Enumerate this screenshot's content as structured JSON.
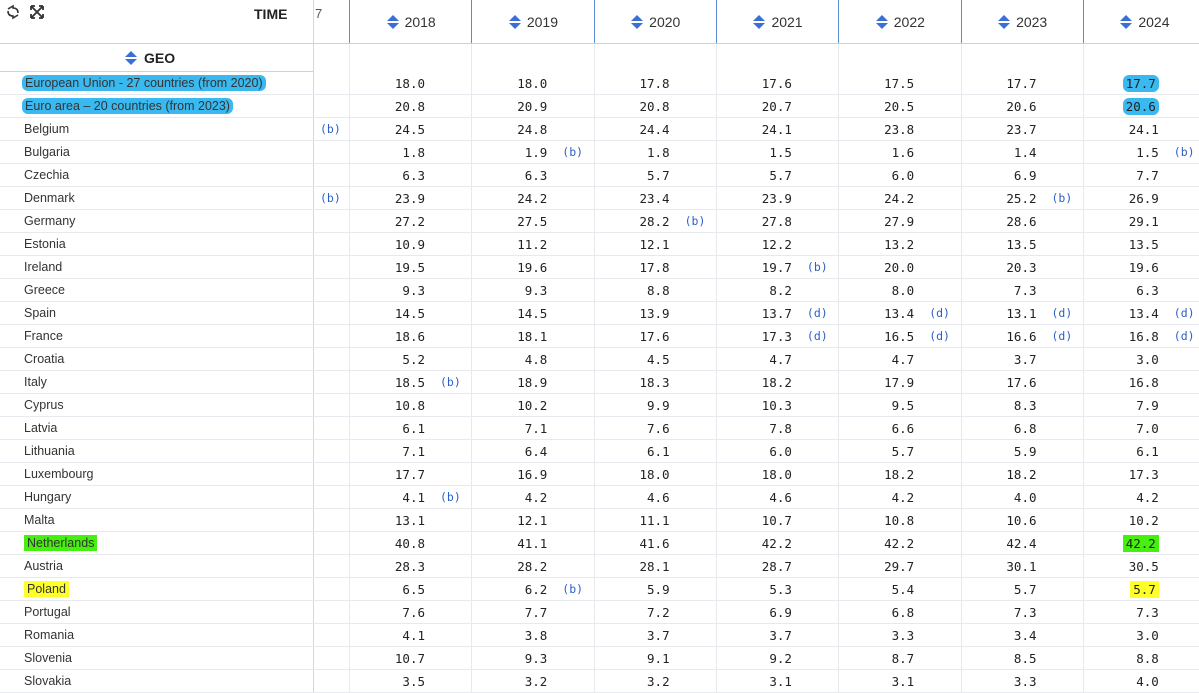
{
  "header": {
    "time_label": "TIME",
    "geo_label": "GEO",
    "partial_col": "7",
    "years": [
      "2018",
      "2019",
      "2020",
      "2021",
      "2022",
      "2023",
      "2024"
    ]
  },
  "icons": [
    "refresh-icon",
    "fullscreen-icon",
    "sort-icon"
  ],
  "colors": {
    "accent": "#3b6fd8",
    "flag": "#2c5fc9",
    "hl_blue": "#39b9ef",
    "hl_green": "#45ef0e",
    "hl_yellow": "#ffff2a"
  },
  "rows": [
    {
      "country": "European Union - 27 countries (from 2020)",
      "hl": "blue",
      "pre": "",
      "cells": [
        [
          "18.0",
          ""
        ],
        [
          "18.0",
          ""
        ],
        [
          "17.8",
          ""
        ],
        [
          "17.6",
          ""
        ],
        [
          "17.5",
          ""
        ],
        [
          "17.7",
          ""
        ],
        [
          "17.7",
          ""
        ]
      ],
      "hl_last": "blue"
    },
    {
      "country": "Euro area – 20 countries (from 2023)",
      "hl": "blue",
      "pre": "",
      "cells": [
        [
          "20.8",
          ""
        ],
        [
          "20.9",
          ""
        ],
        [
          "20.8",
          ""
        ],
        [
          "20.7",
          ""
        ],
        [
          "20.5",
          ""
        ],
        [
          "20.6",
          ""
        ],
        [
          "20.6",
          ""
        ]
      ],
      "hl_last": "blue"
    },
    {
      "country": "Belgium",
      "hl": "",
      "pre": "(b)",
      "cells": [
        [
          "24.5",
          ""
        ],
        [
          "24.8",
          ""
        ],
        [
          "24.4",
          ""
        ],
        [
          "24.1",
          ""
        ],
        [
          "23.8",
          ""
        ],
        [
          "23.7",
          ""
        ],
        [
          "24.1",
          ""
        ]
      ],
      "hl_last": ""
    },
    {
      "country": "Bulgaria",
      "hl": "",
      "pre": "",
      "cells": [
        [
          "1.8",
          ""
        ],
        [
          "1.9",
          "(b)"
        ],
        [
          "1.8",
          ""
        ],
        [
          "1.5",
          ""
        ],
        [
          "1.6",
          ""
        ],
        [
          "1.4",
          ""
        ],
        [
          "1.5",
          "(b)"
        ]
      ],
      "hl_last": ""
    },
    {
      "country": "Czechia",
      "hl": "",
      "pre": "",
      "cells": [
        [
          "6.3",
          ""
        ],
        [
          "6.3",
          ""
        ],
        [
          "5.7",
          ""
        ],
        [
          "5.7",
          ""
        ],
        [
          "6.0",
          ""
        ],
        [
          "6.9",
          ""
        ],
        [
          "7.7",
          ""
        ]
      ],
      "hl_last": ""
    },
    {
      "country": "Denmark",
      "hl": "",
      "pre": "(b)",
      "cells": [
        [
          "23.9",
          ""
        ],
        [
          "24.2",
          ""
        ],
        [
          "23.4",
          ""
        ],
        [
          "23.9",
          ""
        ],
        [
          "24.2",
          ""
        ],
        [
          "25.2",
          "(b)"
        ],
        [
          "26.9",
          ""
        ]
      ],
      "hl_last": ""
    },
    {
      "country": "Germany",
      "hl": "",
      "pre": "",
      "cells": [
        [
          "27.2",
          ""
        ],
        [
          "27.5",
          ""
        ],
        [
          "28.2",
          "(b)"
        ],
        [
          "27.8",
          ""
        ],
        [
          "27.9",
          ""
        ],
        [
          "28.6",
          ""
        ],
        [
          "29.1",
          ""
        ]
      ],
      "hl_last": ""
    },
    {
      "country": "Estonia",
      "hl": "",
      "pre": "",
      "cells": [
        [
          "10.9",
          ""
        ],
        [
          "11.2",
          ""
        ],
        [
          "12.1",
          ""
        ],
        [
          "12.2",
          ""
        ],
        [
          "13.2",
          ""
        ],
        [
          "13.5",
          ""
        ],
        [
          "13.5",
          ""
        ]
      ],
      "hl_last": ""
    },
    {
      "country": "Ireland",
      "hl": "",
      "pre": "",
      "cells": [
        [
          "19.5",
          ""
        ],
        [
          "19.6",
          ""
        ],
        [
          "17.8",
          ""
        ],
        [
          "19.7",
          "(b)"
        ],
        [
          "20.0",
          ""
        ],
        [
          "20.3",
          ""
        ],
        [
          "19.6",
          ""
        ]
      ],
      "hl_last": ""
    },
    {
      "country": "Greece",
      "hl": "",
      "pre": "",
      "cells": [
        [
          "9.3",
          ""
        ],
        [
          "9.3",
          ""
        ],
        [
          "8.8",
          ""
        ],
        [
          "8.2",
          ""
        ],
        [
          "8.0",
          ""
        ],
        [
          "7.3",
          ""
        ],
        [
          "6.3",
          ""
        ]
      ],
      "hl_last": ""
    },
    {
      "country": "Spain",
      "hl": "",
      "pre": "",
      "cells": [
        [
          "14.5",
          ""
        ],
        [
          "14.5",
          ""
        ],
        [
          "13.9",
          ""
        ],
        [
          "13.7",
          "(d)"
        ],
        [
          "13.4",
          "(d)"
        ],
        [
          "13.1",
          "(d)"
        ],
        [
          "13.4",
          "(d)"
        ]
      ],
      "hl_last": ""
    },
    {
      "country": "France",
      "hl": "",
      "pre": "",
      "cells": [
        [
          "18.6",
          ""
        ],
        [
          "18.1",
          ""
        ],
        [
          "17.6",
          ""
        ],
        [
          "17.3",
          "(d)"
        ],
        [
          "16.5",
          "(d)"
        ],
        [
          "16.6",
          "(d)"
        ],
        [
          "16.8",
          "(d)"
        ]
      ],
      "hl_last": ""
    },
    {
      "country": "Croatia",
      "hl": "",
      "pre": "",
      "cells": [
        [
          "5.2",
          ""
        ],
        [
          "4.8",
          ""
        ],
        [
          "4.5",
          ""
        ],
        [
          "4.7",
          ""
        ],
        [
          "4.7",
          ""
        ],
        [
          "3.7",
          ""
        ],
        [
          "3.0",
          ""
        ]
      ],
      "hl_last": ""
    },
    {
      "country": "Italy",
      "hl": "",
      "pre": "",
      "cells": [
        [
          "18.5",
          "(b)"
        ],
        [
          "18.9",
          ""
        ],
        [
          "18.3",
          ""
        ],
        [
          "18.2",
          ""
        ],
        [
          "17.9",
          ""
        ],
        [
          "17.6",
          ""
        ],
        [
          "16.8",
          ""
        ]
      ],
      "hl_last": ""
    },
    {
      "country": "Cyprus",
      "hl": "",
      "pre": "",
      "cells": [
        [
          "10.8",
          ""
        ],
        [
          "10.2",
          ""
        ],
        [
          "9.9",
          ""
        ],
        [
          "10.3",
          ""
        ],
        [
          "9.5",
          ""
        ],
        [
          "8.3",
          ""
        ],
        [
          "7.9",
          ""
        ]
      ],
      "hl_last": ""
    },
    {
      "country": "Latvia",
      "hl": "",
      "pre": "",
      "cells": [
        [
          "6.1",
          ""
        ],
        [
          "7.1",
          ""
        ],
        [
          "7.6",
          ""
        ],
        [
          "7.8",
          ""
        ],
        [
          "6.6",
          ""
        ],
        [
          "6.8",
          ""
        ],
        [
          "7.0",
          ""
        ]
      ],
      "hl_last": ""
    },
    {
      "country": "Lithuania",
      "hl": "",
      "pre": "",
      "cells": [
        [
          "7.1",
          ""
        ],
        [
          "6.4",
          ""
        ],
        [
          "6.1",
          ""
        ],
        [
          "6.0",
          ""
        ],
        [
          "5.7",
          ""
        ],
        [
          "5.9",
          ""
        ],
        [
          "6.1",
          ""
        ]
      ],
      "hl_last": ""
    },
    {
      "country": "Luxembourg",
      "hl": "",
      "pre": "",
      "cells": [
        [
          "17.7",
          ""
        ],
        [
          "16.9",
          ""
        ],
        [
          "18.0",
          ""
        ],
        [
          "18.0",
          ""
        ],
        [
          "18.2",
          ""
        ],
        [
          "18.2",
          ""
        ],
        [
          "17.3",
          ""
        ]
      ],
      "hl_last": ""
    },
    {
      "country": "Hungary",
      "hl": "",
      "pre": "",
      "cells": [
        [
          "4.1",
          "(b)"
        ],
        [
          "4.2",
          ""
        ],
        [
          "4.6",
          ""
        ],
        [
          "4.6",
          ""
        ],
        [
          "4.2",
          ""
        ],
        [
          "4.0",
          ""
        ],
        [
          "4.2",
          ""
        ]
      ],
      "hl_last": ""
    },
    {
      "country": "Malta",
      "hl": "",
      "pre": "",
      "cells": [
        [
          "13.1",
          ""
        ],
        [
          "12.1",
          ""
        ],
        [
          "11.1",
          ""
        ],
        [
          "10.7",
          ""
        ],
        [
          "10.8",
          ""
        ],
        [
          "10.6",
          ""
        ],
        [
          "10.2",
          ""
        ]
      ],
      "hl_last": ""
    },
    {
      "country": "Netherlands",
      "hl": "green",
      "pre": "",
      "cells": [
        [
          "40.8",
          ""
        ],
        [
          "41.1",
          ""
        ],
        [
          "41.6",
          ""
        ],
        [
          "42.2",
          ""
        ],
        [
          "42.2",
          ""
        ],
        [
          "42.4",
          ""
        ],
        [
          "42.2",
          ""
        ]
      ],
      "hl_last": "green"
    },
    {
      "country": "Austria",
      "hl": "",
      "pre": "",
      "cells": [
        [
          "28.3",
          ""
        ],
        [
          "28.2",
          ""
        ],
        [
          "28.1",
          ""
        ],
        [
          "28.7",
          ""
        ],
        [
          "29.7",
          ""
        ],
        [
          "30.1",
          ""
        ],
        [
          "30.5",
          ""
        ]
      ],
      "hl_last": ""
    },
    {
      "country": "Poland",
      "hl": "yellow",
      "pre": "",
      "cells": [
        [
          "6.5",
          ""
        ],
        [
          "6.2",
          "(b)"
        ],
        [
          "5.9",
          ""
        ],
        [
          "5.3",
          ""
        ],
        [
          "5.4",
          ""
        ],
        [
          "5.7",
          ""
        ],
        [
          "5.7",
          ""
        ]
      ],
      "hl_last": "yellow"
    },
    {
      "country": "Portugal",
      "hl": "",
      "pre": "",
      "cells": [
        [
          "7.6",
          ""
        ],
        [
          "7.7",
          ""
        ],
        [
          "7.2",
          ""
        ],
        [
          "6.9",
          ""
        ],
        [
          "6.8",
          ""
        ],
        [
          "7.3",
          ""
        ],
        [
          "7.3",
          ""
        ]
      ],
      "hl_last": ""
    },
    {
      "country": "Romania",
      "hl": "",
      "pre": "",
      "cells": [
        [
          "4.1",
          ""
        ],
        [
          "3.8",
          ""
        ],
        [
          "3.7",
          ""
        ],
        [
          "3.7",
          ""
        ],
        [
          "3.3",
          ""
        ],
        [
          "3.4",
          ""
        ],
        [
          "3.0",
          ""
        ]
      ],
      "hl_last": ""
    },
    {
      "country": "Slovenia",
      "hl": "",
      "pre": "",
      "cells": [
        [
          "10.7",
          ""
        ],
        [
          "9.3",
          ""
        ],
        [
          "9.1",
          ""
        ],
        [
          "9.2",
          ""
        ],
        [
          "8.7",
          ""
        ],
        [
          "8.5",
          ""
        ],
        [
          "8.8",
          ""
        ]
      ],
      "hl_last": ""
    },
    {
      "country": "Slovakia",
      "hl": "",
      "pre": "",
      "cells": [
        [
          "3.5",
          ""
        ],
        [
          "3.2",
          ""
        ],
        [
          "3.2",
          ""
        ],
        [
          "3.1",
          ""
        ],
        [
          "3.1",
          ""
        ],
        [
          "3.3",
          ""
        ],
        [
          "4.0",
          ""
        ]
      ],
      "hl_last": ""
    }
  ]
}
